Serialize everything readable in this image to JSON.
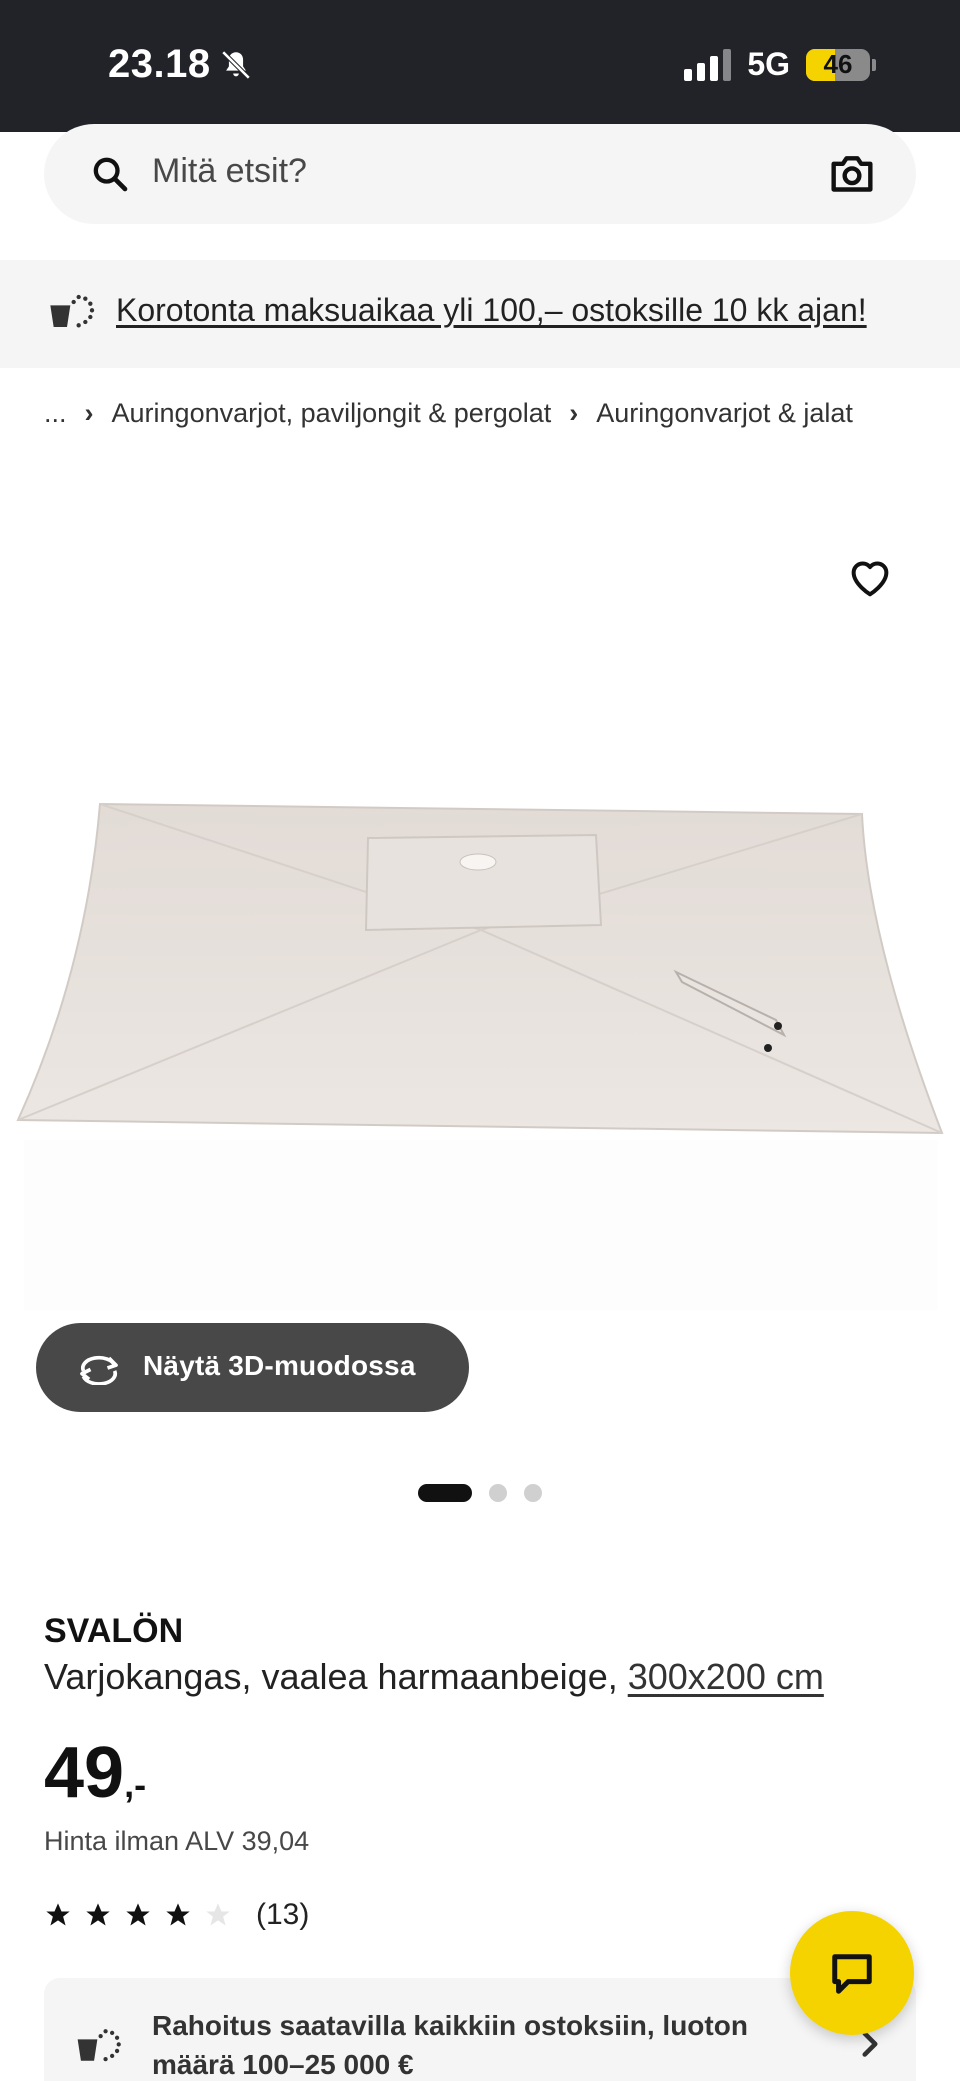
{
  "status_bar": {
    "time": "23.18",
    "network": "5G",
    "battery": "46",
    "battery_level": 0.46
  },
  "search": {
    "placeholder": "Mitä etsit?"
  },
  "promo": {
    "text": "Korotonta maksuaikaa yli 100,– ostoksille 10 kk ajan!"
  },
  "breadcrumb": {
    "ellipsis": "...",
    "items": [
      "Auringonvarjot, paviljongit & pergolat",
      "Auringonvarjot & jalat"
    ]
  },
  "gallery": {
    "view_3d_label": "Näytä 3D-muodossa",
    "dot_count": 3,
    "active_dot": 0
  },
  "product": {
    "brand": "SVALÖN",
    "description": "Varjokangas, vaalea harmaanbeige, ",
    "measure": "300x200 cm",
    "price_integer": "49",
    "price_suffix": ",-",
    "vat_text": "Hinta ilman ALV 39,04",
    "rating": 4,
    "rating_max": 5,
    "review_count": "(13)"
  },
  "financing": {
    "text": "Rahoitus saatavilla kaikkiin ostoksiin, luoton määrä 100–25 000 €"
  },
  "colors": {
    "status_bar_bg": "#222328",
    "accent_yellow": "#f5d300",
    "button_dark": "#484848",
    "surface_grey": "#f5f5f5"
  },
  "icons": {
    "search": "search-icon",
    "camera": "camera-icon",
    "favorite": "heart-icon",
    "chat": "chat-icon",
    "rotate": "rotate-3d-icon",
    "financing": "financing-icon"
  }
}
